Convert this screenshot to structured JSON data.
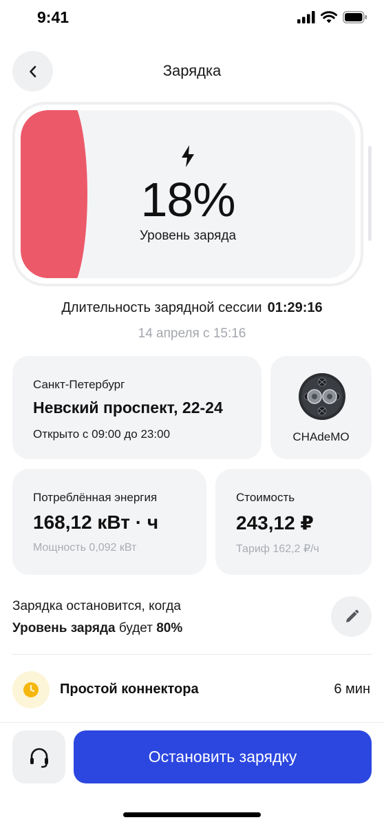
{
  "status_bar": {
    "time": "9:41"
  },
  "header": {
    "title": "Зарядка"
  },
  "battery": {
    "percent_text": "18%",
    "level_fraction": 0.18,
    "label": "Уровень заряда",
    "fill_color": "#ec5a6a"
  },
  "session": {
    "duration_label": "Длительность зарядной сессии",
    "duration_value": "01:29:16",
    "started": "14 апреля с 15:16"
  },
  "station": {
    "city": "Санкт-Петербург",
    "address": "Невский проспект, 22-24",
    "hours": "Открыто с 09:00 до 23:00"
  },
  "connector": {
    "name": "CHAdeMO",
    "icon": "chademo-connector-icon"
  },
  "energy": {
    "label": "Потреблённая энергия",
    "value": "168,12 кВт · ч",
    "power": "Мощность 0,092 кВт"
  },
  "cost": {
    "label": "Стоимость",
    "value": "243,12 ₽",
    "tariff": "Тариф 162,2 ₽/ч"
  },
  "stop_condition": {
    "title": "Зарядка остановится, когда",
    "param": "Уровень заряда",
    "verb": "будет",
    "value": "80%"
  },
  "idle": {
    "label": "Простой коннектора",
    "value": "6 мин",
    "icon": "clock-icon"
  },
  "actions": {
    "stop_label": "Остановить зарядку",
    "accent": "#2c47e0"
  }
}
